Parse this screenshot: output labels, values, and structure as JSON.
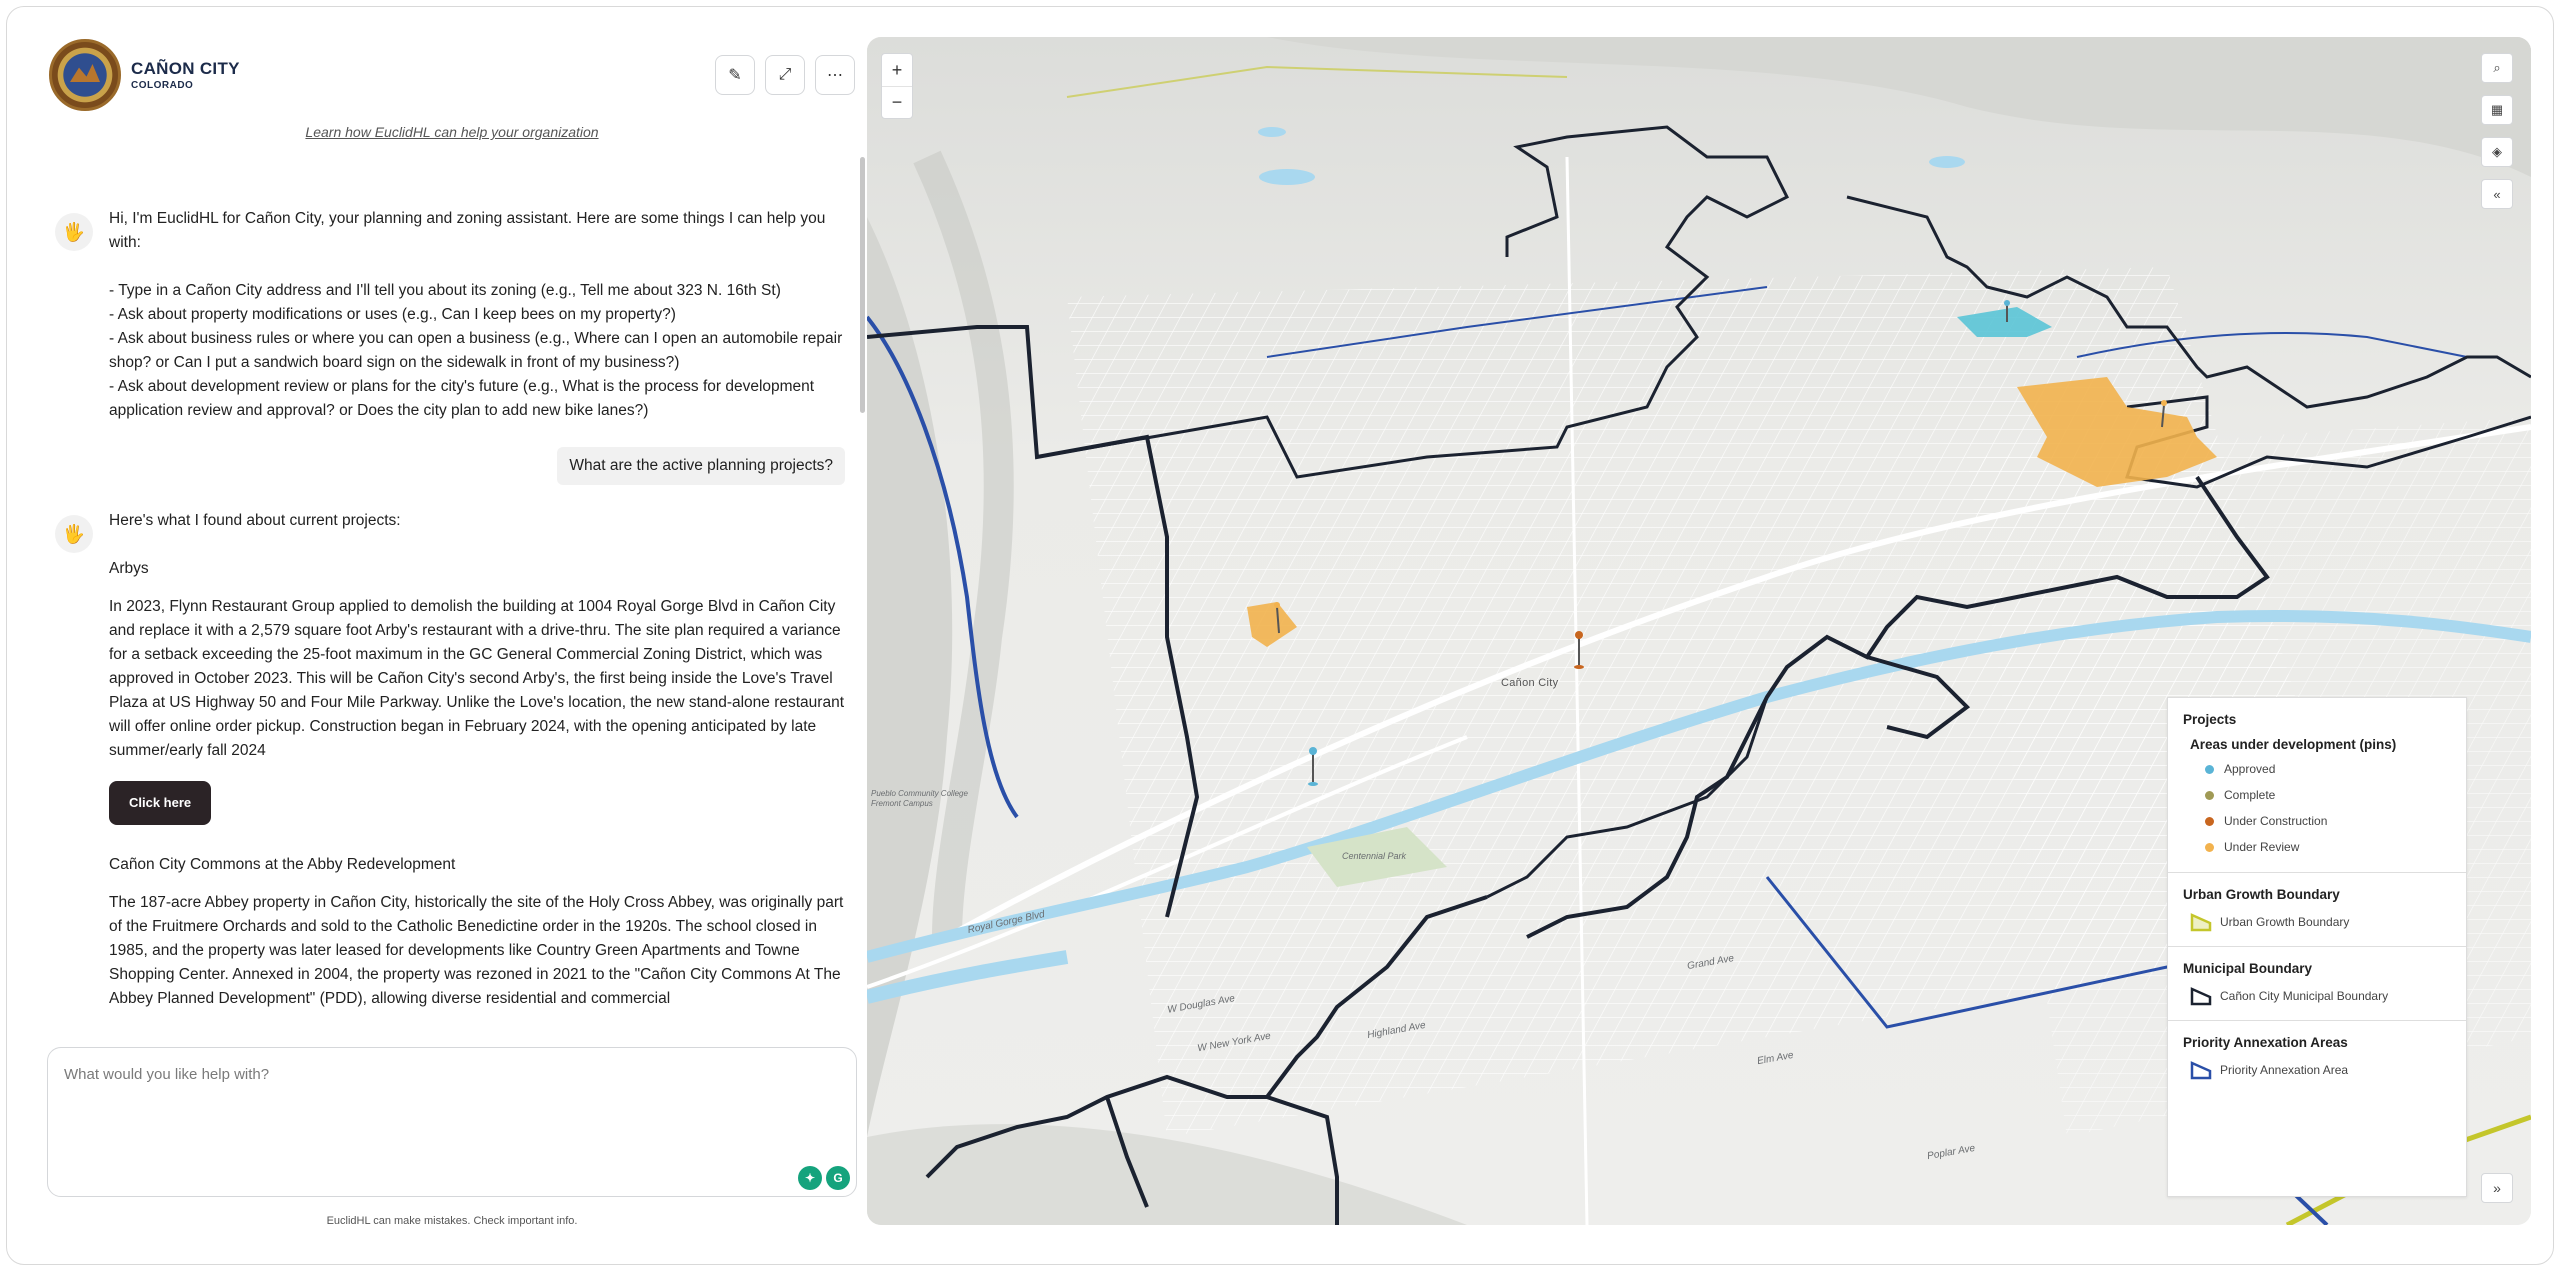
{
  "brand": {
    "name": "CAÑON CITY",
    "state": "COLORADO"
  },
  "header": {
    "learn_link": "Learn how EuclidHL can help your organization",
    "edit_icon": "edit-icon",
    "expand_icon": "expand-icon",
    "more_icon": "more-icon"
  },
  "chat": {
    "greeting": {
      "intro": "Hi, I'm EuclidHL for Cañon City, your planning and zoning assistant. Here are some things I can help you with:",
      "bullets": [
        "- Type in a Cañon City address and I'll tell you about its zoning (e.g., Tell me about 323 N. 16th St)",
        "- Ask about property modifications or uses (e.g., Can I keep bees on my property?)",
        "- Ask about business rules or where you can open a business (e.g., Where can I open an automobile repair shop? or Can I put a sandwich board sign on the sidewalk in front of my business?)",
        "- Ask about development review or plans for the city's future (e.g., What is the process for development application review and approval? or Does the city plan to add new bike lanes?)"
      ]
    },
    "user_question": "What are the active planning projects?",
    "answer": {
      "intro": "Here's what I found about current projects:",
      "project1_title": "Arbys",
      "project1_body": "In 2023, Flynn Restaurant Group applied to demolish the building at 1004 Royal Gorge Blvd in Cañon City and replace it with a 2,579 square foot Arby's restaurant with a drive-thru. The site plan required a variance for a setback exceeding the 25-foot maximum in the GC General Commercial Zoning District, which was approved in October 2023. This will be Cañon City's second Arby's, the first being inside the Love's Travel Plaza at US Highway 50 and Four Mile Parkway. Unlike the Love's location, the new stand-alone restaurant will offer online order pickup. Construction began in February 2024, with the opening anticipated by late summer/early fall 2024",
      "button_label": "Click here",
      "project2_title": "Cañon City Commons at the Abby Redevelopment",
      "project2_body": "The 187-acre Abbey property in Cañon City, historically the site of the Holy Cross Abbey, was originally part of the Fruitmere Orchards and sold to the Catholic Benedictine order in the 1920s. The school closed in 1985, and the property was later leased for developments like Country Green Apartments and Towne Shopping Center. Annexed in 2004, the property was rezoned in 2021 to the \"Cañon City Commons At The Abbey Planned Development\" (PDD), allowing diverse residential and commercial"
    }
  },
  "input": {
    "placeholder": "What would you like help with?",
    "disclaimer": "EuclidHL can make mistakes. Check important info."
  },
  "map": {
    "zoom_in": "+",
    "zoom_out": "−",
    "tools": [
      "search-icon",
      "qr-icon",
      "layers-icon",
      "collapse-icon"
    ],
    "expand_label": "»",
    "labels": {
      "city": "Cañon City",
      "royal_gorge": "Royal Gorge Blvd",
      "park": "Centennial Park",
      "college": "Pueblo Community College Fremont Campus",
      "douglas": "W Douglas Ave",
      "newyork": "W New York Ave",
      "highland": "Highland Ave",
      "poplar": "Poplar Ave",
      "elm": "Elm Ave",
      "grand": "Grand Ave"
    },
    "colors": {
      "approved": "#5ab4d6",
      "complete": "#a09a55",
      "under_construction": "#c8661f",
      "under_review": "#f2b24e",
      "ugb": "#c4c62b",
      "municipal": "#1b2230",
      "priority": "#2a4fa8",
      "river": "#a9d8ef"
    }
  },
  "legend": {
    "title": "Projects",
    "pins_heading": "Areas under development (pins)",
    "pins": [
      {
        "label": "Approved",
        "color": "#5ab4d6"
      },
      {
        "label": "Complete",
        "color": "#a09a55"
      },
      {
        "label": "Under Construction",
        "color": "#c8661f"
      },
      {
        "label": "Under Review",
        "color": "#f2b24e"
      }
    ],
    "ugb_heading": "Urban Growth Boundary",
    "ugb_item": "Urban Growth Boundary",
    "municipal_heading": "Municipal Boundary",
    "municipal_item": "Cañon City Municipal Boundary",
    "priority_heading": "Priority Annexation Areas",
    "priority_item": "Priority Annexation Area"
  }
}
